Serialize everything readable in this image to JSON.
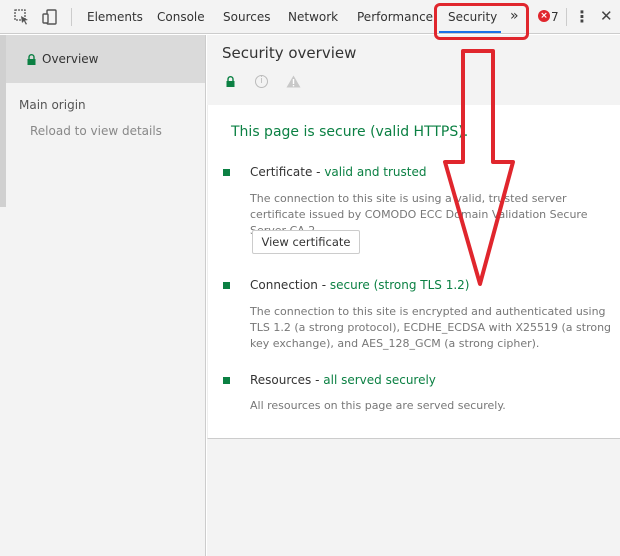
{
  "toolbar": {
    "tabs": [
      "Elements",
      "Console",
      "Sources",
      "Network",
      "Performance",
      "Security"
    ],
    "more": "»",
    "error_count": "7",
    "error_badge": "×",
    "kebab": "⋮",
    "close": "✕"
  },
  "sidebar": {
    "overview": "Overview",
    "main_origin": "Main origin",
    "reload": "Reload to view details"
  },
  "main": {
    "title": "Security overview",
    "info_icon": "i",
    "warn_icon": "!",
    "secure_message": "This page is secure (valid HTTPS).",
    "certificate": {
      "label": "Certificate",
      "sep": " - ",
      "status": "valid and trusted",
      "description": "The connection to this site is using a valid, trusted server certificate issued by COMODO ECC Domain Validation Secure Server CA 2.",
      "button": "View certificate"
    },
    "connection": {
      "label": "Connection",
      "sep": " - ",
      "status": "secure (strong TLS 1.2)",
      "description": "The connection to this site is encrypted and authenticated using TLS 1.2 (a strong protocol), ECDHE_ECDSA with X25519 (a strong key exchange), and AES_128_GCM (a strong cipher)."
    },
    "resources": {
      "label": "Resources",
      "sep": " - ",
      "status": "all served securely",
      "description": "All resources on this page are served securely."
    }
  },
  "colors": {
    "secure_green": "#0b8043",
    "annotation_red": "#e0262d",
    "active_tab_underline": "#1a73e8"
  }
}
